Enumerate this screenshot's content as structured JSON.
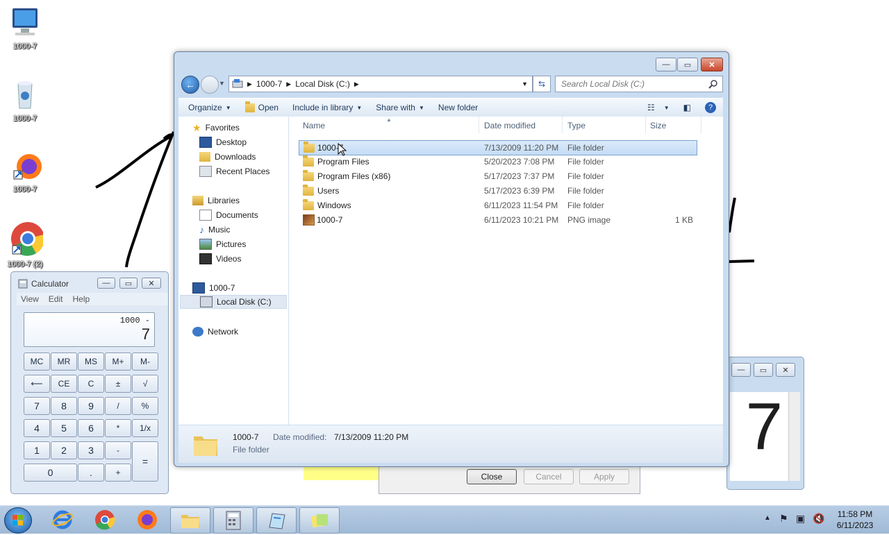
{
  "desktop": {
    "icons": [
      {
        "label": "1000-7",
        "icon": "computer-icon"
      },
      {
        "label": "1000-7",
        "icon": "recycle-bin-icon"
      },
      {
        "label": "1000-7",
        "icon": "firefox-icon"
      },
      {
        "label": "1000-7 (2)",
        "icon": "chrome-icon"
      }
    ]
  },
  "explorer": {
    "address": {
      "seg1": "1000-7",
      "seg2": "Local Disk (C:)"
    },
    "search_placeholder": "Search Local Disk (C:)",
    "toolbar": {
      "organize": "Organize",
      "open": "Open",
      "include": "Include in library",
      "share": "Share with",
      "new_folder": "New folder"
    },
    "nav": {
      "favorites": "Favorites",
      "desktop": "Desktop",
      "downloads": "Downloads",
      "recent": "Recent Places",
      "libraries": "Libraries",
      "documents": "Documents",
      "music": "Music",
      "pictures": "Pictures",
      "videos": "Videos",
      "computer": "1000-7",
      "local_disk": "Local Disk (C:)",
      "network": "Network"
    },
    "columns": {
      "name": "Name",
      "date": "Date modified",
      "type": "Type",
      "size": "Size"
    },
    "rows": [
      {
        "name": "1000-7",
        "date": "7/13/2009 11:20 PM",
        "type": "File folder",
        "size": ""
      },
      {
        "name": "Program Files",
        "date": "5/20/2023 7:08 PM",
        "type": "File folder",
        "size": ""
      },
      {
        "name": "Program Files (x86)",
        "date": "5/17/2023 7:37 PM",
        "type": "File folder",
        "size": ""
      },
      {
        "name": "Users",
        "date": "5/17/2023 6:39 PM",
        "type": "File folder",
        "size": ""
      },
      {
        "name": "Windows",
        "date": "6/11/2023 11:54 PM",
        "type": "File folder",
        "size": ""
      },
      {
        "name": "1000-7",
        "date": "6/11/2023 10:21 PM",
        "type": "PNG image",
        "size": "1 KB"
      }
    ],
    "status": {
      "name": "1000-7",
      "date_label": "Date modified:",
      "date": "7/13/2009 11:20 PM",
      "type": "File folder"
    }
  },
  "calculator": {
    "title": "Calculator",
    "menu": [
      "View",
      "Edit",
      "Help"
    ],
    "display_expr": "1000 -",
    "display_value": "7",
    "keys": {
      "mc": "MC",
      "mr": "MR",
      "ms": "MS",
      "mplus": "M+",
      "mminus": "M-",
      "back": "⟵",
      "ce": "CE",
      "c": "C",
      "pm": "±",
      "sqrt": "√",
      "k7": "7",
      "k8": "8",
      "k9": "9",
      "div": "/",
      "pct": "%",
      "k4": "4",
      "k5": "5",
      "k6": "6",
      "mul": "*",
      "inv": "1/x",
      "k1": "1",
      "k2": "2",
      "k3": "3",
      "sub": "-",
      "eq": "=",
      "k0": "0",
      "dot": ".",
      "add": "+"
    }
  },
  "background_window": {
    "big_value": "7"
  },
  "dialog": {
    "close": "Close",
    "cancel": "Cancel",
    "apply": "Apply"
  },
  "tray": {
    "time": "11:58 PM",
    "date": "6/11/2023"
  }
}
